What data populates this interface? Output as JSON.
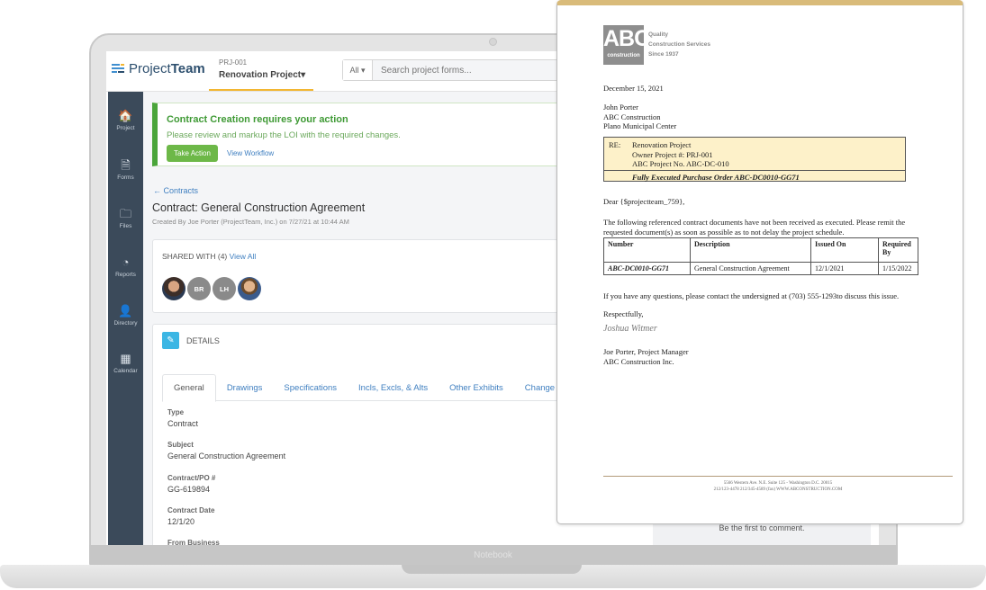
{
  "device": {
    "label": "Notebook"
  },
  "app": {
    "logo": {
      "text_light": "Project",
      "text_bold": "Team"
    },
    "project": {
      "code": "PRJ-001",
      "name": "Renovation Project",
      "caret": "▾"
    },
    "search": {
      "filter": "All ▾",
      "placeholder": "Search project forms..."
    }
  },
  "sidebar": {
    "items": [
      {
        "label": "Project",
        "icon": "home-icon",
        "glyph": "🏠"
      },
      {
        "label": "Forms",
        "icon": "document-icon",
        "glyph": "🗎"
      },
      {
        "label": "Files",
        "icon": "folder-icon",
        "glyph": "🗀"
      },
      {
        "label": "Reports",
        "icon": "gauge-icon",
        "glyph": "◔"
      },
      {
        "label": "Directory",
        "icon": "contact-book-icon",
        "glyph": "👤"
      },
      {
        "label": "Calendar",
        "icon": "calendar-icon",
        "glyph": "▦"
      }
    ]
  },
  "alert": {
    "title": "Contract Creation requires your action",
    "message": "Please review and markup the LOI with the required changes.",
    "primary_button": "Take Action",
    "secondary_link": "View Workflow"
  },
  "page": {
    "back_link": "← Contracts",
    "title": "Contract: General Construction Agreement",
    "created": "Created By Joe Porter (ProjectTeam, Inc.) on 7/27/21 at 10:44 AM"
  },
  "shared": {
    "label": "SHARED WITH (4)",
    "view_all": "View All",
    "avatars": [
      {
        "type": "photo",
        "initials": ""
      },
      {
        "type": "initials",
        "initials": "BR"
      },
      {
        "type": "initials",
        "initials": "LH"
      },
      {
        "type": "photo",
        "initials": ""
      }
    ]
  },
  "details": {
    "title": "DETAILS",
    "tabs": [
      "General",
      "Drawings",
      "Specifications",
      "Incls, Excls, & Alts",
      "Other Exhibits",
      "Change Or"
    ],
    "active_tab": "General",
    "fields": [
      {
        "label": "Type",
        "value": "Contract"
      },
      {
        "label": "Subject",
        "value": "General Construction Agreement"
      },
      {
        "label": "Contract/PO #",
        "value": "GG-619894"
      },
      {
        "label": "Contract Date",
        "value": "12/1/20"
      },
      {
        "label": "From Business",
        "value": ""
      }
    ]
  },
  "comments": {
    "empty": "Be the first to comment."
  },
  "letter": {
    "logo": {
      "big": "ABC",
      "small": "construction"
    },
    "tagline": [
      "Quality",
      "Construction Services",
      "Since 1937"
    ],
    "date": "December 15, 2021",
    "recipient": [
      "John Porter",
      "ABC Construction",
      "Plano Municipal Center"
    ],
    "re": {
      "label": "RE:",
      "lines": [
        "Renovation Project",
        "Owner Project #: PRJ-001",
        "ABC Project No. ABC-DC-010"
      ],
      "po": "Fully Executed Purchase Order ABC-DC0010-GG71"
    },
    "greeting": "Dear {$projectteam_759},",
    "body": "The following referenced contract documents have not been received as executed.  Please remit the requested document(s) as soon as possible as to not delay the project schedule.",
    "table": {
      "headers": [
        "Number",
        "Description",
        "Issued On",
        "Required By"
      ],
      "rows": [
        [
          "ABC-DC0010-GG71",
          "General Construction Agreement",
          "12/1/2021",
          "1/15/2022"
        ]
      ]
    },
    "questions": "If you have any questions, please contact the undersigned at (703) 555-1293to discuss this issue.",
    "closing": "Respectfully,",
    "signature": "Joshua Witmer",
    "signer": [
      "Joe Porter, Project Manager",
      "ABC Construction Inc."
    ],
    "footer": [
      "5566 Western Ave. N.E. Suite 125 - Washington D.C. 20015",
      "212/123-4478   212/345-4589 (fax) WWW.ABCONSTRUCTION.COM"
    ]
  }
}
